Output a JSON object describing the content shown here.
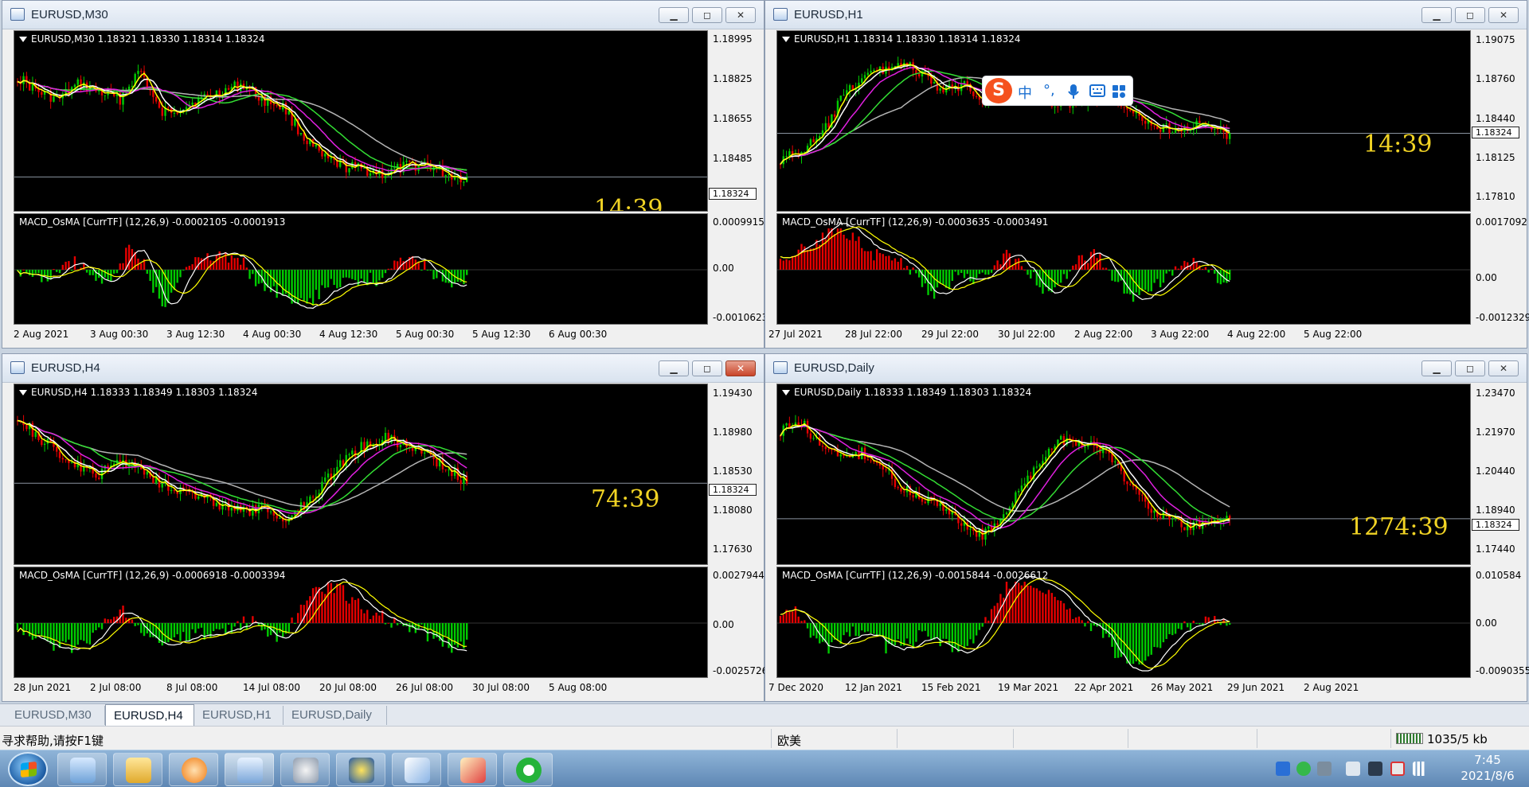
{
  "windows": [
    {
      "key": "m30",
      "title": "EURUSD,M30",
      "header": "EURUSD,M30  1.18321 1.18330 1.18314 1.18324",
      "timer": "14:39",
      "prices": [
        "1.18995",
        "1.18825",
        "1.18655",
        "1.18485",
        "1.18324"
      ],
      "current_price": "1.18324",
      "osc_header": "MACD_OsMA [CurrTF] (12,26,9) -0.0002105 -0.0001913",
      "osc_scale": [
        "0.0009915",
        "0.00",
        "-0.0010623"
      ],
      "dates": [
        "2 Aug 2021",
        "3 Aug 00:30",
        "3 Aug 12:30",
        "4 Aug 00:30",
        "4 Aug 12:30",
        "5 Aug 00:30",
        "5 Aug 12:30",
        "6 Aug 00:30"
      ]
    },
    {
      "key": "h1",
      "title": "EURUSD,H1",
      "header": "EURUSD,H1  1.18314 1.18330 1.18314 1.18324",
      "timer": "14:39",
      "prices": [
        "1.19075",
        "1.18760",
        "1.18440",
        "1.18324",
        "1.18125",
        "1.17810"
      ],
      "current_price": "1.18324",
      "osc_header": "MACD_OsMA [CurrTF] (12,26,9) -0.0003635 -0.0003491",
      "osc_scale": [
        "0.0017092",
        "0.00",
        "-0.0012329"
      ],
      "dates": [
        "27 Jul 2021",
        "28 Jul 22:00",
        "29 Jul 22:00",
        "30 Jul 22:00",
        "2 Aug 22:00",
        "3 Aug 22:00",
        "4 Aug 22:00",
        "5 Aug 22:00"
      ]
    },
    {
      "key": "h4",
      "title": "EURUSD,H4",
      "header": "EURUSD,H4  1.18333 1.18349 1.18303 1.18324",
      "timer": "74:39",
      "prices": [
        "1.19430",
        "1.18980",
        "1.18530",
        "1.18324",
        "1.18080",
        "1.17630"
      ],
      "current_price": "1.18324",
      "osc_header": "MACD_OsMA [CurrTF] (12,26,9) -0.0006918 -0.0003394",
      "osc_scale": [
        "0.0027944",
        "0.00",
        "-0.0025726"
      ],
      "dates": [
        "28 Jun 2021",
        "2 Jul 08:00",
        "8 Jul 08:00",
        "14 Jul 08:00",
        "20 Jul 08:00",
        "26 Jul 08:00",
        "30 Jul 08:00",
        "5 Aug 08:00"
      ]
    },
    {
      "key": "daily",
      "title": "EURUSD,Daily",
      "header": "EURUSD,Daily  1.18333 1.18349 1.18303 1.18324",
      "timer": "1274:39",
      "prices": [
        "1.23470",
        "1.21970",
        "1.20440",
        "1.18940",
        "1.18324",
        "1.17440"
      ],
      "current_price": "1.18324",
      "osc_header": "MACD_OsMA [CurrTF] (12,26,9) -0.0015844 -0.0026612",
      "osc_scale": [
        "0.010584",
        "0.00",
        "-0.0090355"
      ],
      "dates": [
        "7 Dec 2020",
        "12 Jan 2021",
        "15 Feb 2021",
        "19 Mar 2021",
        "22 Apr 2021",
        "26 May 2021",
        "29 Jun 2021",
        "2 Aug 2021"
      ]
    }
  ],
  "window_buttons": {
    "minimize": "▁",
    "maximize": "◻",
    "close": "✕"
  },
  "tabs": [
    {
      "label": "EURUSD,M30",
      "active": false
    },
    {
      "label": "EURUSD,H4",
      "active": true
    },
    {
      "label": "EURUSD,H1",
      "active": false
    },
    {
      "label": "EURUSD,Daily",
      "active": false
    }
  ],
  "status": {
    "help": "寻求帮助,请按F1键",
    "profile": "欧美",
    "traffic": "1035/5 kb"
  },
  "ime": {
    "logo": "S",
    "mode": "中",
    "punct": "°,",
    "icons": [
      "microphone-icon",
      "keyboard-icon",
      "toolbox-icon"
    ]
  },
  "clock": {
    "time": "7:45",
    "date": "2021/8/6"
  },
  "taskbar_apps": [
    "remote-desktop-icon",
    "folder-icon",
    "refresh-app-icon",
    "metatrader-icon",
    "screenshot-app-icon",
    "dollar-app-icon",
    "notepad-icon",
    "paint-icon",
    "wechat-icon"
  ],
  "tray_icons": [
    "shield-icon",
    "wechat-tray-icon",
    "antenna-icon",
    "speaker-icon",
    "monitor-icon",
    "mute-icon",
    "signal-icon"
  ],
  "colors": {
    "bull": "#00cc00",
    "bear": "#e60000",
    "ma_fast": "#ffff00",
    "ma_white": "#ffffff",
    "ma_magenta": "#e020e0",
    "ma_green": "#33dd33",
    "ma_gray": "#b4b4b4",
    "timer": "#f1d324"
  }
}
